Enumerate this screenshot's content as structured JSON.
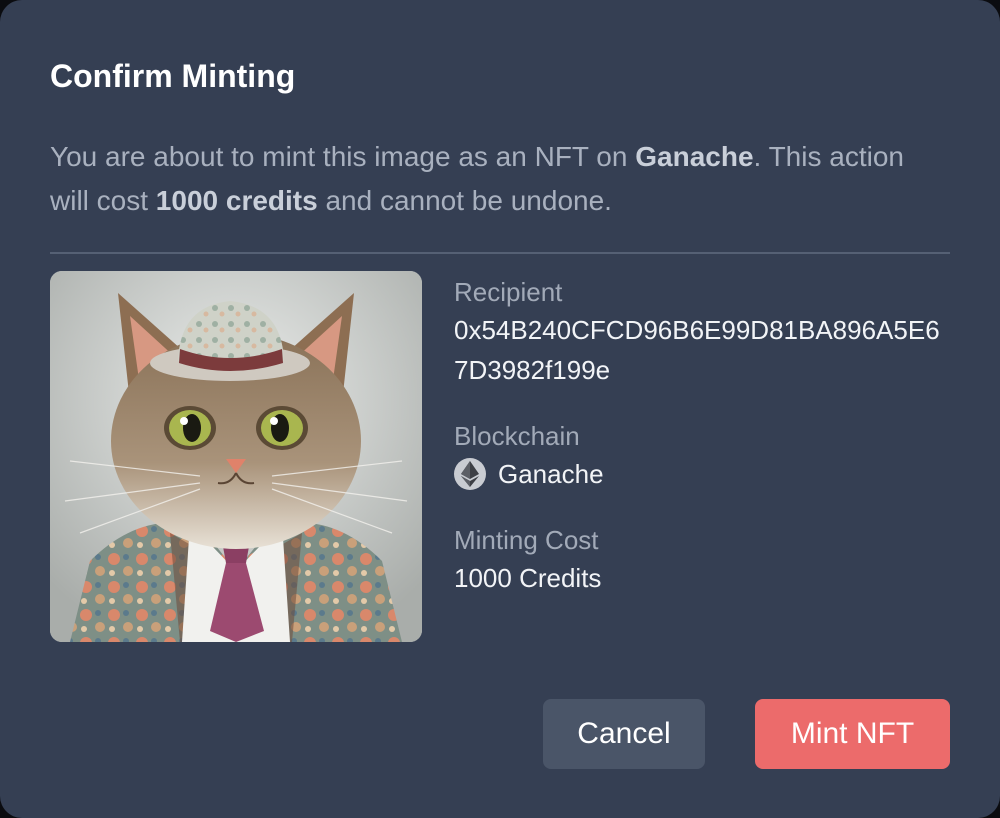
{
  "dialog": {
    "title": "Confirm Minting",
    "description": {
      "part1": "You are about to mint this image as an NFT on ",
      "network": "Ganache",
      "part2": ". This action will cost ",
      "cost": "1000 credits",
      "part3": " and cannot be undone."
    }
  },
  "details": {
    "recipient_label": "Recipient",
    "recipient_value": "0x54B240CFCD96B6E99D81BA896A5E67D3982f199e",
    "blockchain_label": "Blockchain",
    "blockchain_value": "Ganache",
    "blockchain_icon": "ethereum-icon",
    "cost_label": "Minting Cost",
    "cost_value": "1000 Credits"
  },
  "nft_image": {
    "subject": "illustrated cat wearing a hat, floral jacket and tie"
  },
  "actions": {
    "cancel_label": "Cancel",
    "mint_label": "Mint NFT"
  },
  "colors": {
    "background": "#353f53",
    "cancel_button": "#4a5568",
    "mint_button": "#ec6b6b"
  }
}
